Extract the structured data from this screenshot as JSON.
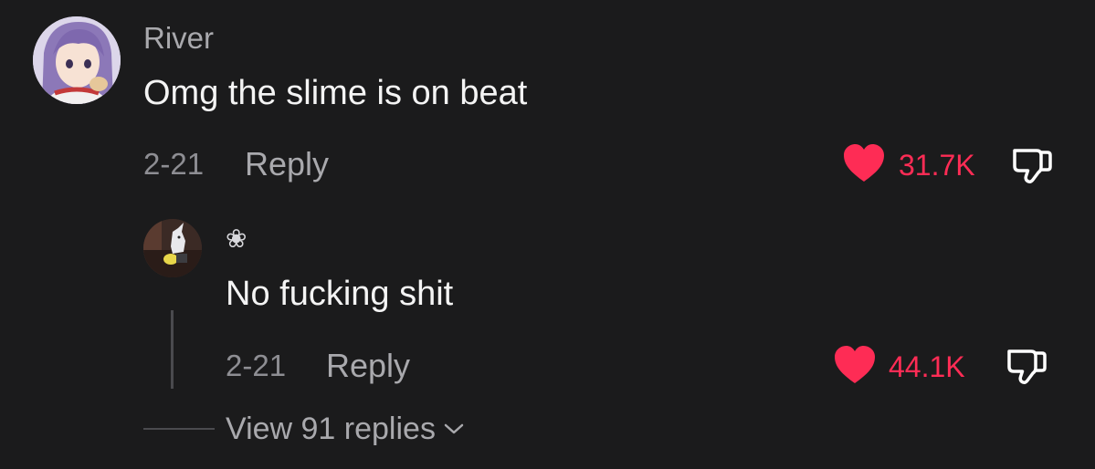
{
  "comment": {
    "username": "River",
    "text": "Omg the slime is on beat",
    "date": "2-21",
    "reply_label": "Reply",
    "likes": "31.7K"
  },
  "reply": {
    "username": "❀",
    "text": "No fucking shit",
    "date": "2-21",
    "reply_label": "Reply",
    "likes": "44.1K"
  },
  "view_replies": "View 91 replies",
  "colors": {
    "background": "#1b1b1c",
    "like": "#fe2c55",
    "muted": "#a9a9ad"
  },
  "icons": [
    "heart-icon",
    "dislike-icon",
    "chevron-down-icon",
    "flower-icon"
  ]
}
